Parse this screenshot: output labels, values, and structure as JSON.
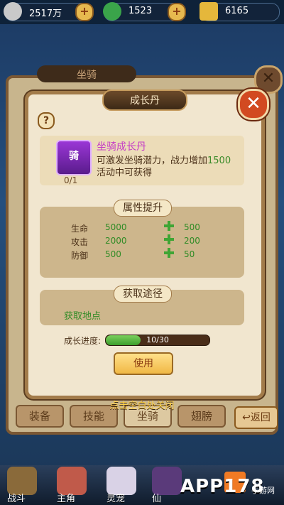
{
  "top_bar": {
    "coins": "2517万",
    "jade": "1523",
    "gold": "6165",
    "colors": {
      "coin": "#c9c9c9",
      "jade": "#3aa44a",
      "gold": "#e5b73b"
    }
  },
  "background_panel": {
    "title": "坐骑",
    "tabs": [
      "装备",
      "技能",
      "坐骑",
      "翅膀"
    ],
    "return_label": "返回",
    "close_icon": "close-x"
  },
  "dialog": {
    "title": "成长丹",
    "help_label": "?",
    "close_label": "✕",
    "item": {
      "icon_char": "骑",
      "count": "0/1",
      "name": "坐骑成长丹",
      "desc_prefix": "可激发坐骑潜力，战力增加",
      "desc_value": "1500",
      "source_note": "活动中可获得"
    },
    "attributes": {
      "header": "属性提升",
      "rows": [
        {
          "name": "生命",
          "base": "5000",
          "increase": "500"
        },
        {
          "name": "攻击",
          "base": "2000",
          "increase": "200"
        },
        {
          "name": "防御",
          "base": "500",
          "increase": "50"
        }
      ]
    },
    "sources": {
      "header": "获取途径",
      "location_label": "获取地点"
    },
    "progress": {
      "label": "成长进度:",
      "text": "10/30",
      "fraction": 0.333
    },
    "use_button": "使用"
  },
  "close_hint": "点击空白处关闭",
  "bottom_nav": {
    "items": [
      {
        "label": "战斗",
        "icon": "sword-icon"
      },
      {
        "label": "主角",
        "icon": "hero-portrait"
      },
      {
        "label": "灵宠",
        "icon": "pet-portrait"
      },
      {
        "label": "仙",
        "icon": "immortal-portrait"
      }
    ]
  },
  "watermark": {
    "main": "APP178",
    "sub": "手游网"
  }
}
